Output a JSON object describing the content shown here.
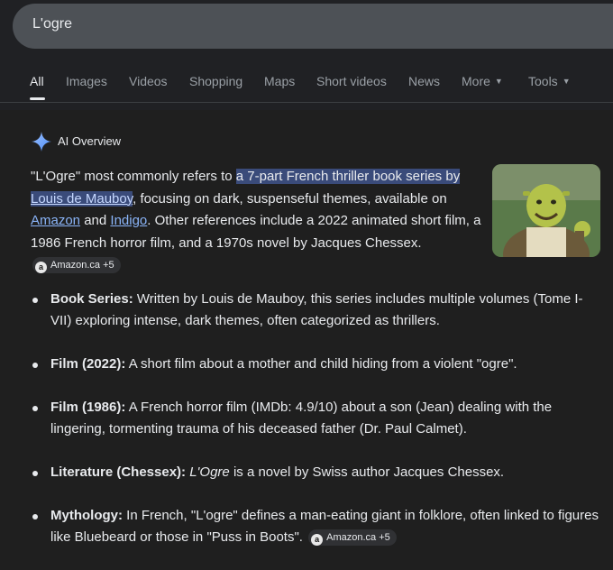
{
  "search": {
    "query": "L'ogre"
  },
  "tabs": [
    {
      "label": "All",
      "active": true
    },
    {
      "label": "Images"
    },
    {
      "label": "Videos"
    },
    {
      "label": "Shopping"
    },
    {
      "label": "Maps"
    },
    {
      "label": "Short videos"
    },
    {
      "label": "News"
    },
    {
      "label": "More"
    },
    {
      "label": "Tools"
    }
  ],
  "ai_overview": {
    "title": "AI Overview",
    "icon": "sparkle-icon",
    "accent_color": "#8ab4f8",
    "highlight_color": "#3a4b7a",
    "summary": {
      "t1": "\"L'Ogre\" most commonly refers to ",
      "h1": "a 7-part French thriller book series by ",
      "link_author": "Louis de Mauboy",
      "t2": ", focusing on dark, suspenseful themes, available on ",
      "link_amazon": "Amazon",
      "t3": " and ",
      "link_indigo": "Indigo",
      "t4": ". Other references include a 2022 animated short film, a 1986 French horror film, and a 1970s novel by Jacques Chessex. ",
      "chip": {
        "logo": "a",
        "label": "Amazon.ca +5"
      }
    },
    "image": {
      "alt": "Shrek ogre character",
      "icon": "ogre-thumbnail"
    },
    "bullets": [
      {
        "term": "Book Series:",
        "text": " Written by Louis de Mauboy, this series includes multiple volumes (Tome I-VII) exploring intense, dark themes, often categorized as thrillers."
      },
      {
        "term": "Film (2022):",
        "text": " A short film about a mother and child hiding from a violent \"ogre\"."
      },
      {
        "term": "Film (1986):",
        "text": " A French horror film (IMDb: 4.9/10) about a son (Jean) dealing with the lingering, tormenting trauma of his deceased father (Dr. Paul Calmet)."
      },
      {
        "term": "Literature (Chessex):",
        "italic": "L'Ogre",
        "text": " is a novel by Swiss author Jacques Chessex."
      },
      {
        "term": "Mythology:",
        "text": " In French, \"L'ogre\" defines a man-eating giant in folklore, often linked to figures like Bluebeard or those in \"Puss in Boots\". ",
        "chip": {
          "logo": "a",
          "label": "Amazon.ca +5"
        }
      }
    ]
  }
}
